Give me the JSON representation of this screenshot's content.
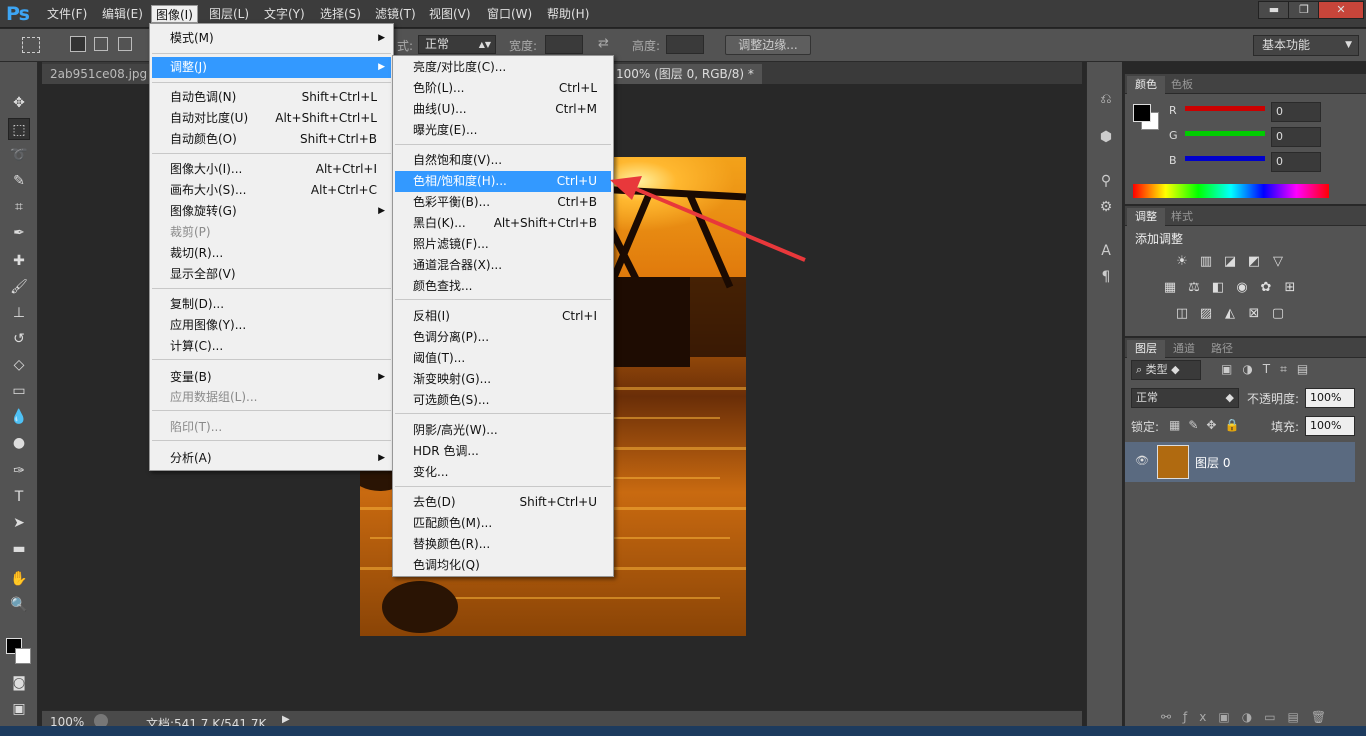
{
  "app": {
    "logo": "Ps"
  },
  "menubar": {
    "items": [
      "文件(F)",
      "编辑(E)",
      "图像(I)",
      "图层(L)",
      "文字(Y)",
      "选择(S)",
      "滤镜(T)",
      "视图(V)",
      "窗口(W)",
      "帮助(H)"
    ]
  },
  "window_controls": {
    "min": "▬",
    "restore": "❐",
    "close": "✕"
  },
  "options": {
    "style_label": "式:",
    "style_value": "正常",
    "width_label": "宽度:",
    "height_label": "高度:",
    "refine_button": "调整边缘...",
    "workspace": "基本功能"
  },
  "tabs": [
    {
      "label": "2ab951ce08.jpg @"
    },
    {
      "label": "100% (图层 0, RGB/8) *"
    }
  ],
  "status": {
    "zoom": "100%",
    "doc": "文档:541.7 K/541.7K"
  },
  "image_menu": {
    "items": [
      {
        "label": "模式(M)",
        "shortcut": "",
        "sub": true
      },
      {
        "label": "调整(J)",
        "shortcut": "",
        "sub": true
      },
      {
        "label": "自动色调(N)",
        "shortcut": "Shift+Ctrl+L"
      },
      {
        "label": "自动对比度(U)",
        "shortcut": "Alt+Shift+Ctrl+L"
      },
      {
        "label": "自动颜色(O)",
        "shortcut": "Shift+Ctrl+B"
      },
      {
        "label": "图像大小(I)...",
        "shortcut": "Alt+Ctrl+I"
      },
      {
        "label": "画布大小(S)...",
        "shortcut": "Alt+Ctrl+C"
      },
      {
        "label": "图像旋转(G)",
        "shortcut": "",
        "sub": true
      },
      {
        "label": "裁剪(P)",
        "shortcut": ""
      },
      {
        "label": "裁切(R)...",
        "shortcut": ""
      },
      {
        "label": "显示全部(V)",
        "shortcut": ""
      },
      {
        "label": "复制(D)...",
        "shortcut": ""
      },
      {
        "label": "应用图像(Y)...",
        "shortcut": ""
      },
      {
        "label": "计算(C)...",
        "shortcut": ""
      },
      {
        "label": "变量(B)",
        "shortcut": "",
        "sub": true
      },
      {
        "label": "应用数据组(L)...",
        "shortcut": ""
      },
      {
        "label": "陷印(T)...",
        "shortcut": ""
      },
      {
        "label": "分析(A)",
        "shortcut": "",
        "sub": true
      }
    ]
  },
  "adjust_menu": {
    "items": [
      {
        "label": "亮度/对比度(C)...",
        "shortcut": ""
      },
      {
        "label": "色阶(L)...",
        "shortcut": "Ctrl+L"
      },
      {
        "label": "曲线(U)...",
        "shortcut": "Ctrl+M"
      },
      {
        "label": "曝光度(E)...",
        "shortcut": ""
      },
      {
        "label": "自然饱和度(V)...",
        "shortcut": ""
      },
      {
        "label": "色相/饱和度(H)...",
        "shortcut": "Ctrl+U"
      },
      {
        "label": "色彩平衡(B)...",
        "shortcut": "Ctrl+B"
      },
      {
        "label": "黑白(K)...",
        "shortcut": "Alt+Shift+Ctrl+B"
      },
      {
        "label": "照片滤镜(F)...",
        "shortcut": ""
      },
      {
        "label": "通道混合器(X)...",
        "shortcut": ""
      },
      {
        "label": "颜色查找...",
        "shortcut": ""
      },
      {
        "label": "反相(I)",
        "shortcut": "Ctrl+I"
      },
      {
        "label": "色调分离(P)...",
        "shortcut": ""
      },
      {
        "label": "阈值(T)...",
        "shortcut": ""
      },
      {
        "label": "渐变映射(G)...",
        "shortcut": ""
      },
      {
        "label": "可选颜色(S)...",
        "shortcut": ""
      },
      {
        "label": "阴影/高光(W)...",
        "shortcut": ""
      },
      {
        "label": "HDR 色调...",
        "shortcut": ""
      },
      {
        "label": "变化...",
        "shortcut": ""
      },
      {
        "label": "去色(D)",
        "shortcut": "Shift+Ctrl+U"
      },
      {
        "label": "匹配颜色(M)...",
        "shortcut": ""
      },
      {
        "label": "替换颜色(R)...",
        "shortcut": ""
      },
      {
        "label": "色调均化(Q)",
        "shortcut": ""
      }
    ]
  },
  "color_panel": {
    "tabs": [
      "颜色",
      "色板"
    ],
    "r_label": "R",
    "g_label": "G",
    "b_label": "B",
    "r": "0",
    "g": "0",
    "b": "0",
    "r_color": "#ff0000",
    "g_color": "#00ff00",
    "b_color": "#0000ff"
  },
  "adjust_panel": {
    "tabs": [
      "调整",
      "样式"
    ],
    "title": "添加调整"
  },
  "layers_panel": {
    "tabs": [
      "图层",
      "通道",
      "路径"
    ],
    "filter": "类型",
    "blend": "正常",
    "opacity_label": "不透明度:",
    "opacity": "100%",
    "lock_label": "锁定:",
    "fill_label": "填充:",
    "fill": "100%",
    "layer_name": "图层 0"
  },
  "accent": "#3399ff",
  "annotation_color": "#e8383b"
}
